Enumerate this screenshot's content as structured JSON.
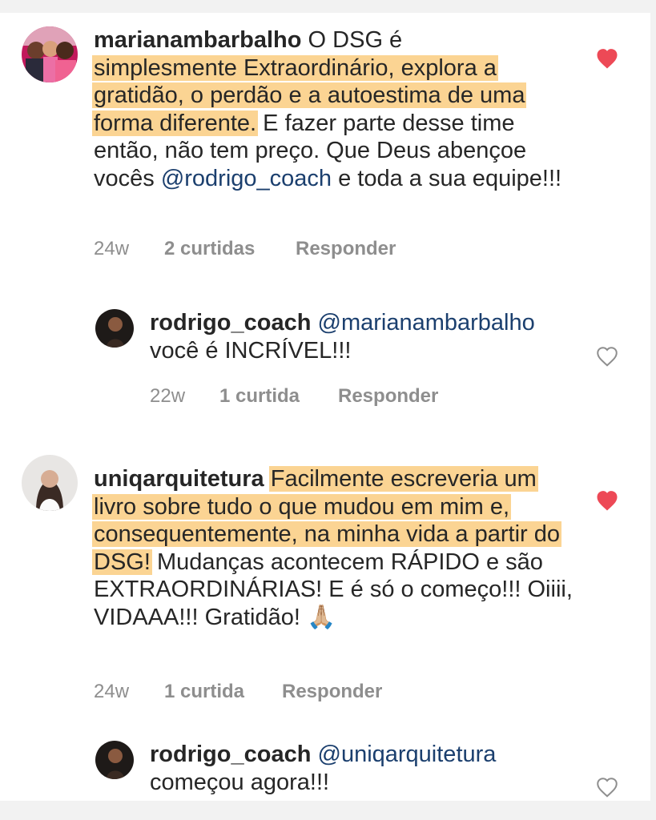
{
  "comments": [
    {
      "username": "marianambarbalho",
      "lead": "O DSG é",
      "highlight": "simplesmente Extraordinário, explora a gratidão, o perdão e a autoestima de uma forma diferente.",
      "rest_a": "E fazer parte desse time então, não tem preço. Que Deus abençoe vocês",
      "mention": "@rodrigo_coach",
      "rest_b": "e toda a sua equipe!!!",
      "time": "24w",
      "likes": "2 curtidas",
      "reply": "Responder",
      "liked": true
    },
    {
      "username": "rodrigo_coach",
      "mention": "@marianambarbalho",
      "text": "você é INCRÍVEL!!!",
      "time": "22w",
      "likes": "1 curtida",
      "reply": "Responder",
      "liked": false
    },
    {
      "username": "uniqarquitetura",
      "highlight": "Facilmente escreveria um livro sobre tudo o que mudou em mim e, consequentemente, na minha vida a partir do DSG!",
      "rest": "Mudanças acontecem RÁPIDO e são EXTRAORDINÁRIAS! E é só o começo!!! Oiiii, VIDAAA!!! Gratidão!",
      "emoji": "🙏🏼",
      "time": "24w",
      "likes": "1 curtida",
      "reply": "Responder",
      "liked": true
    },
    {
      "username": "rodrigo_coach",
      "mention": "@uniqarquitetura",
      "text": "começou agora!!!",
      "liked": false
    }
  ],
  "colors": {
    "liked": "#ed4956",
    "unliked": "#8e8e8e",
    "highlight": "#fbd493",
    "mention": "#1b3f6e",
    "meta": "#8e8e8e"
  }
}
